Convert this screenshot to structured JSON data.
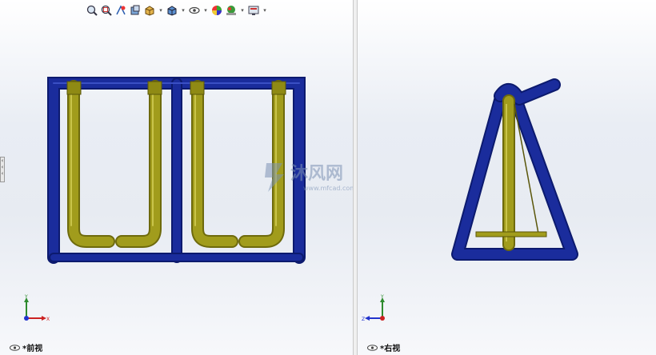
{
  "toolbar": {
    "icons": [
      "zoom-to-fit-icon",
      "zoom-area-icon",
      "previous-view-icon",
      "section-view-icon",
      "view-orientation-icon",
      "display-style-icon",
      "hide-show-items-icon",
      "edit-appearance-icon",
      "apply-scene-icon",
      "view-settings-icon"
    ]
  },
  "views": {
    "left": {
      "label": "*前视"
    },
    "right": {
      "label": "*右视"
    }
  },
  "triad": {
    "y_axis": "Y",
    "x_axis": "X",
    "z_axis": "Z"
  },
  "watermark": {
    "brand": "沐风网",
    "url": "www.mfcad.com"
  },
  "colors": {
    "frame_blue": "#1a2c9c",
    "handle_olive": "#a19c1c",
    "axis_y": "#2e8b2e",
    "axis_x": "#cc2222",
    "axis_z": "#2233cc"
  }
}
